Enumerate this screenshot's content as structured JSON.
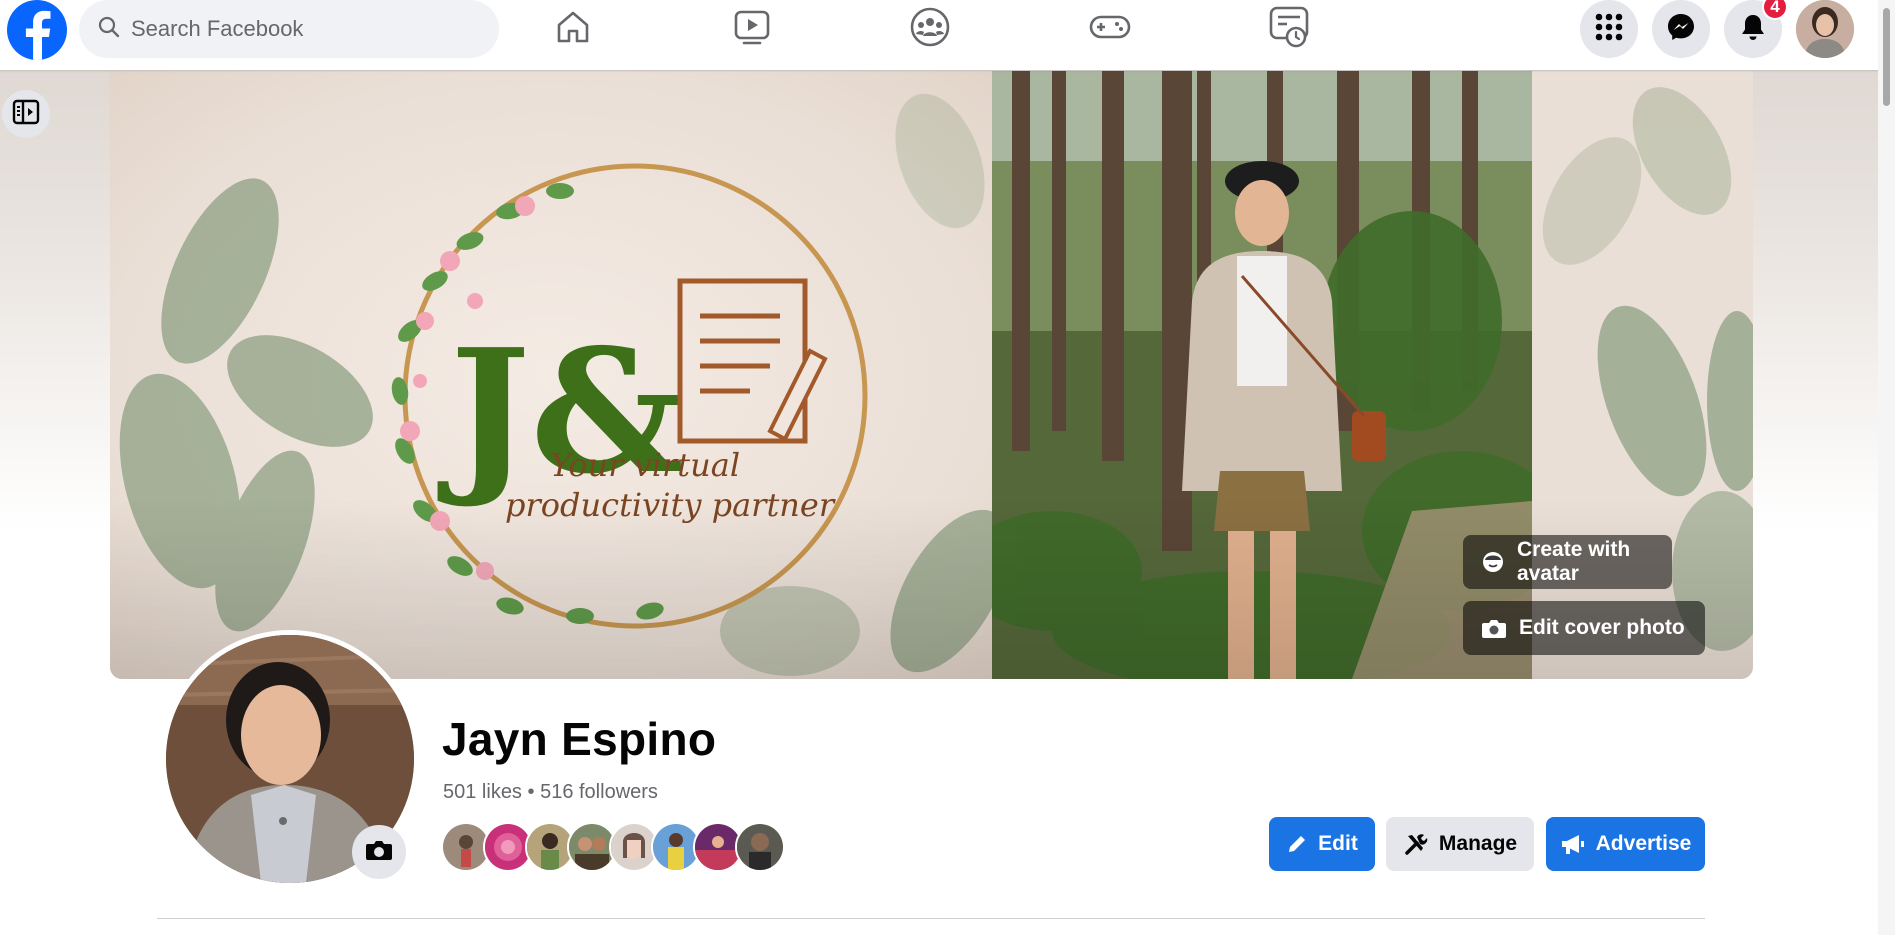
{
  "topbar": {
    "search_placeholder": "Search Facebook",
    "nav_tabs": [
      "home",
      "video",
      "groups",
      "gaming",
      "feeds"
    ],
    "notification_count": "4",
    "accent_color": "#0866ff"
  },
  "cover": {
    "logo_monogram": "J&",
    "logo_tagline_line1": "Your virtual",
    "logo_tagline_line2": "productivity partner",
    "create_avatar_label": "Create with avatar",
    "edit_cover_label": "Edit cover photo"
  },
  "profile": {
    "name": "Jayn Espino",
    "likes": "501 likes",
    "separator": "•",
    "followers": "516 followers",
    "follower_faces": [
      "#7a6a5a",
      "#d94a8b",
      "#9a8458",
      "#b07c5a",
      "#c8b7a8",
      "#d9b45a",
      "#8a2f4a",
      "#5a4a3a"
    ]
  },
  "actions": {
    "edit_label": "Edit",
    "manage_label": "Manage",
    "advertise_label": "Advertise"
  }
}
